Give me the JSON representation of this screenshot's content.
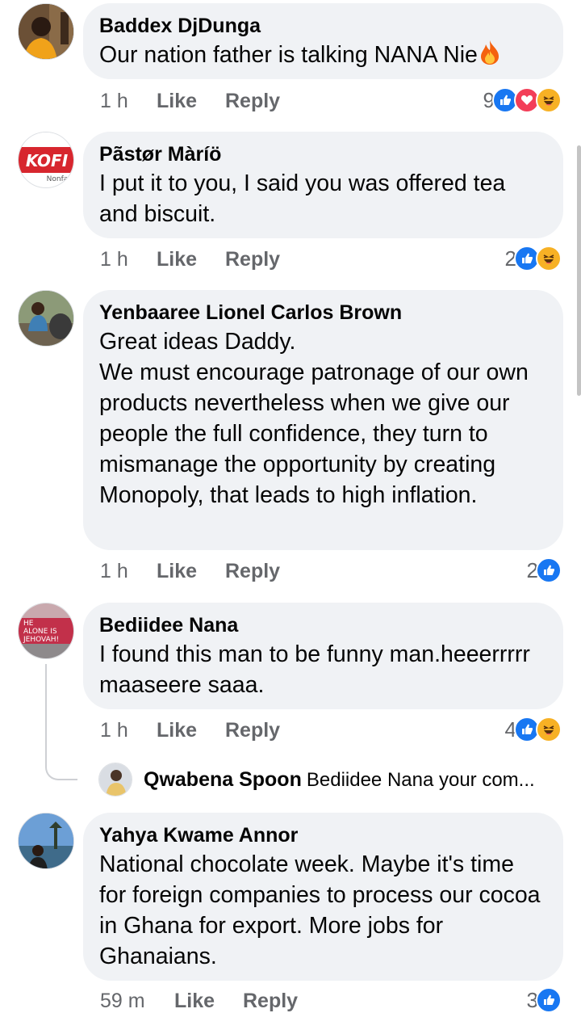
{
  "comments": [
    {
      "author": "Baddex DjDunga",
      "text": "Our nation father is talking NANA Nie",
      "emoji": "fire",
      "time": "1 h",
      "like_label": "Like",
      "reply_label": "Reply",
      "reaction_count": "9",
      "reactions": [
        "like",
        "love",
        "haha"
      ]
    },
    {
      "author": "Pãstør Màríö",
      "text": "I put it to you, I said you was offered tea and biscuit.",
      "avatar_badge": "KOFI",
      "avatar_subtext": "Nonfa",
      "time": "1 h",
      "like_label": "Like",
      "reply_label": "Reply",
      "reaction_count": "2",
      "reactions": [
        "like",
        "haha"
      ]
    },
    {
      "author": "Yenbaaree Lionel Carlos Brown",
      "text": "Great ideas Daddy.\nWe must encourage patronage of our own products nevertheless when we give our people the full confidence, they turn to mismanage the opportunity by creating Monopoly, that leads to high inflation.",
      "time": "1 h",
      "like_label": "Like",
      "reply_label": "Reply",
      "reaction_count": "2",
      "reactions": [
        "like"
      ]
    },
    {
      "author": "Bediidee Nana",
      "text": "I found this man to be funny man.heeerrrrr maaseere saaa.",
      "avatar_banner": [
        "HE",
        "ALONE IS",
        "JEHOVAH!"
      ],
      "time": "1 h",
      "like_label": "Like",
      "reply_label": "Reply",
      "reaction_count": "4",
      "reactions": [
        "like",
        "haha"
      ]
    },
    {
      "author": "Yahya Kwame Annor",
      "text": "National chocolate week. Maybe it's time for foreign companies to process our cocoa in Ghana for export. More jobs for Ghanaians.",
      "time": "59 m",
      "like_label": "Like",
      "reply_label": "Reply",
      "reaction_count": "3",
      "reactions": [
        "like"
      ]
    }
  ],
  "reply_preview": {
    "author": "Qwabena Spoon",
    "text": "Bediidee Nana your com..."
  },
  "colors": {
    "bubble": "#f0f2f5",
    "meta_text": "#65676b",
    "like_blue": "#1877f2",
    "love_red": "#f33e58",
    "haha_yellow": "#f7b125"
  }
}
